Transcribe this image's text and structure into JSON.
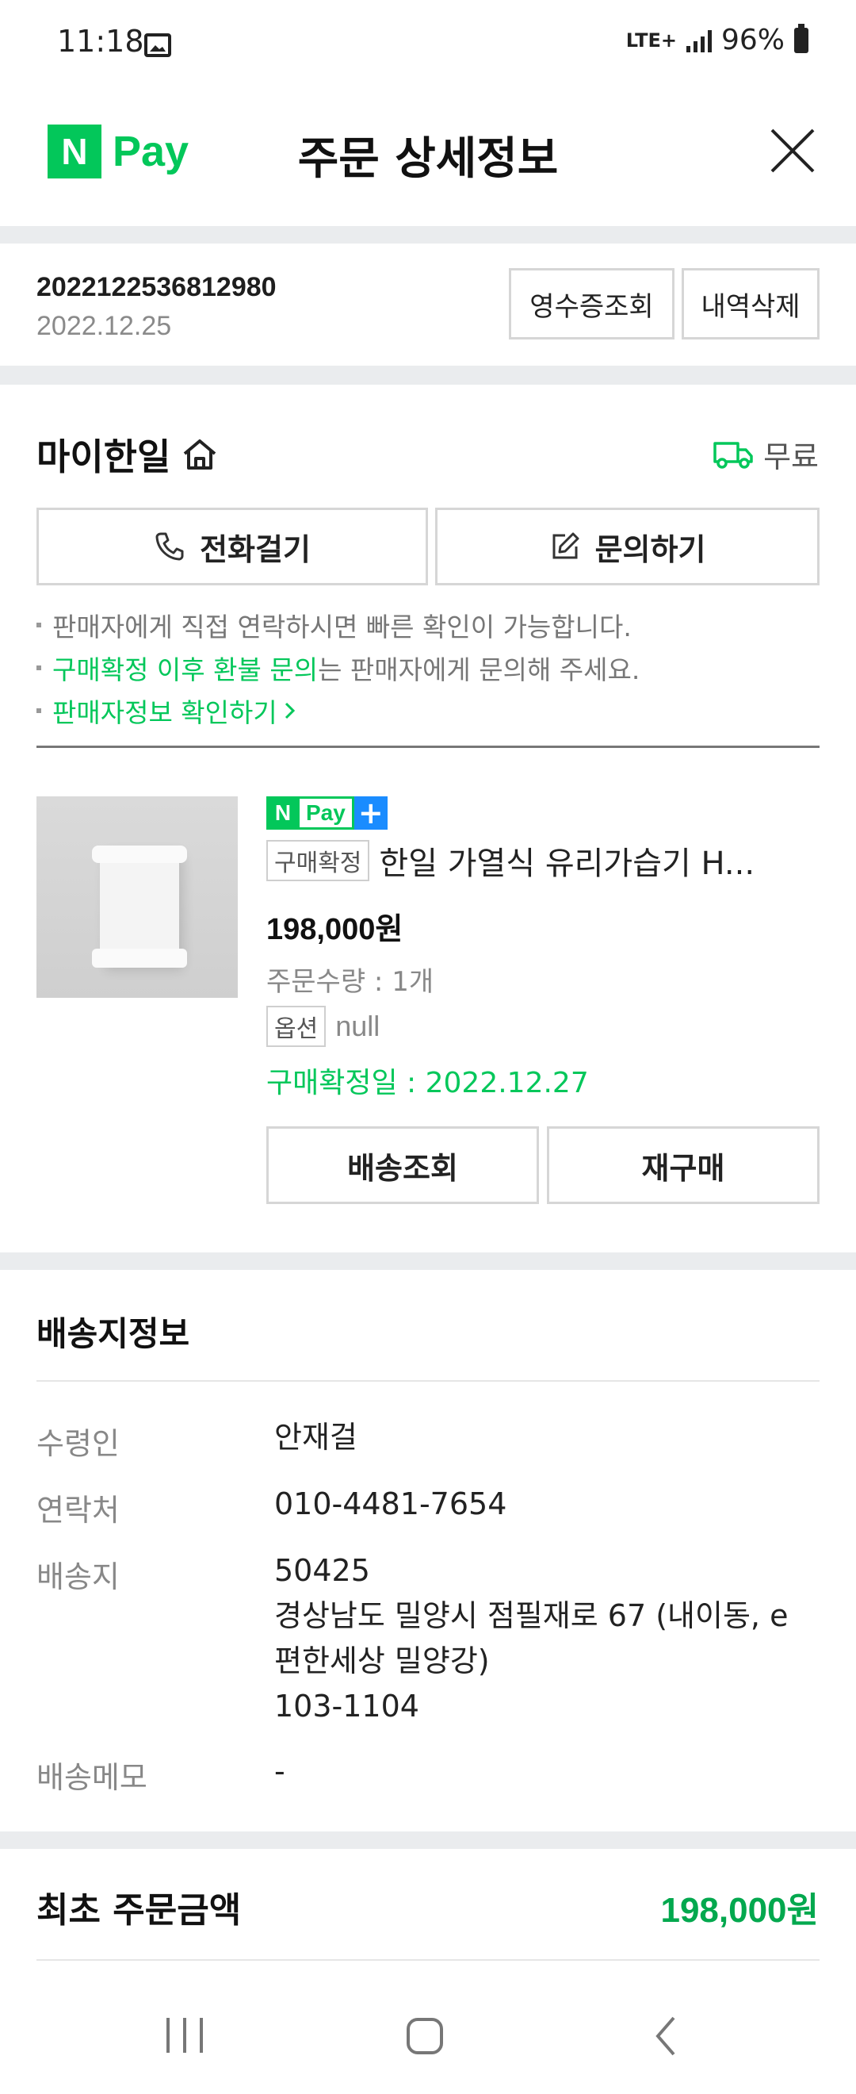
{
  "status_bar": {
    "time": "11:18",
    "network": "LTE+",
    "battery": "96%",
    "icons": [
      "gallery-icon",
      "signal-icon",
      "battery-icon"
    ]
  },
  "header": {
    "logo_n": "N",
    "logo_pay": "Pay",
    "title": "주문 상세정보",
    "close_icon": "close-icon"
  },
  "order": {
    "number": "2022122536812980",
    "date": "2022.12.25",
    "receipt_button": "영수증조회",
    "delete_button": "내역삭제"
  },
  "seller": {
    "name": "마이한일",
    "shipping_fee": "무료",
    "call_button": "전화걸기",
    "inquiry_button": "문의하기",
    "notices": {
      "line1": "판매자에게 직접 연락하시면 빠른 확인이 가능합니다.",
      "line2_highlight": "구매확정 이후 환불 문의",
      "line2_rest": "는 판매자에게 문의해 주세요.",
      "line3": "판매자정보 확인하기"
    }
  },
  "product": {
    "badge_n": "N",
    "badge_pay": "Pay",
    "badge_plus": "+",
    "status_tag": "구매확정",
    "name": "한일 가열식 유리가습기 H...",
    "price": "198,000원",
    "quantity": "주문수량 : 1개",
    "option_tag": "옵션",
    "option_value": "null",
    "confirm_date": "구매확정일 : 2022.12.27",
    "track_button": "배송조회",
    "rebuy_button": "재구매"
  },
  "delivery": {
    "title": "배송지정보",
    "recipient_label": "수령인",
    "recipient": "안재걸",
    "contact_label": "연락처",
    "contact": "010-4481-7654",
    "address_label": "배송지",
    "address_zip": "50425",
    "address_line1": "경상남도 밀양시 점필재로 67 (내이동, e",
    "address_line2": "편한세상 밀양강)",
    "address_line3": "103-1104",
    "memo_label": "배송메모",
    "memo": "-"
  },
  "summary": {
    "label": "최초 주문금액",
    "value": "198,000원"
  },
  "colors": {
    "brand_green": "#03c75a",
    "total_green": "#03a84e",
    "divider": "#eaecee"
  }
}
